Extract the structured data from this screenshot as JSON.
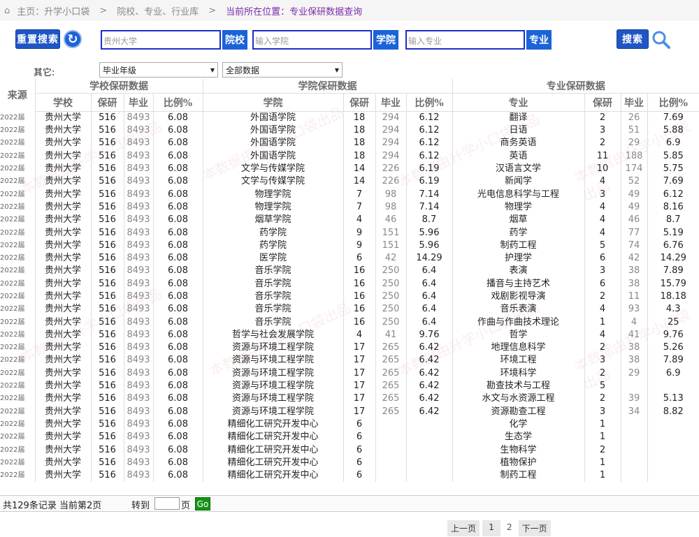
{
  "breadcrumb": {
    "home": "主页：升学小口袋",
    "level2": "院校、专业、行业库",
    "current": "当前所在位置：专业保研数据查询"
  },
  "toolbar": {
    "reset_label": "重置搜索",
    "school_input_value": "贵州大学",
    "school_btn": "院校",
    "college_placeholder": "输入学院",
    "college_btn": "学院",
    "major_placeholder": "输入专业",
    "major_btn": "专业",
    "search_label": "搜索"
  },
  "filters": {
    "label": "其它:",
    "grad_year": "毕业年级",
    "data_scope": "全部数据"
  },
  "table": {
    "col_source": "来源",
    "group_school": "学校保研数据",
    "group_college": "学院保研数据",
    "group_major": "专业保研数据",
    "h_school": "学校",
    "h_baoyan": "保研",
    "h_grad": "毕业",
    "h_ratio": "比例%",
    "h_college": "学院",
    "h_major": "专业",
    "rows": [
      {
        "src": "2022届",
        "school": "贵州大学",
        "sb": "516",
        "sg": "8493",
        "sr": "6.08",
        "college": "外国语学院",
        "cb": "18",
        "cg": "294",
        "cr": "6.12",
        "major": "翻译",
        "mb": "2",
        "mg": "26",
        "mr": "7.69"
      },
      {
        "src": "2022届",
        "school": "贵州大学",
        "sb": "516",
        "sg": "8493",
        "sr": "6.08",
        "college": "外国语学院",
        "cb": "18",
        "cg": "294",
        "cr": "6.12",
        "major": "日语",
        "mb": "3",
        "mg": "51",
        "mr": "5.88"
      },
      {
        "src": "2022届",
        "school": "贵州大学",
        "sb": "516",
        "sg": "8493",
        "sr": "6.08",
        "college": "外国语学院",
        "cb": "18",
        "cg": "294",
        "cr": "6.12",
        "major": "商务英语",
        "mb": "2",
        "mg": "29",
        "mr": "6.9"
      },
      {
        "src": "2022届",
        "school": "贵州大学",
        "sb": "516",
        "sg": "8493",
        "sr": "6.08",
        "college": "外国语学院",
        "cb": "18",
        "cg": "294",
        "cr": "6.12",
        "major": "英语",
        "mb": "11",
        "mg": "188",
        "mr": "5.85"
      },
      {
        "src": "2022届",
        "school": "贵州大学",
        "sb": "516",
        "sg": "8493",
        "sr": "6.08",
        "college": "文学与传媒学院",
        "cb": "14",
        "cg": "226",
        "cr": "6.19",
        "major": "汉语言文学",
        "mb": "10",
        "mg": "174",
        "mr": "5.75"
      },
      {
        "src": "2022届",
        "school": "贵州大学",
        "sb": "516",
        "sg": "8493",
        "sr": "6.08",
        "college": "文学与传媒学院",
        "cb": "14",
        "cg": "226",
        "cr": "6.19",
        "major": "新闻学",
        "mb": "4",
        "mg": "52",
        "mr": "7.69"
      },
      {
        "src": "2022届",
        "school": "贵州大学",
        "sb": "516",
        "sg": "8493",
        "sr": "6.08",
        "college": "物理学院",
        "cb": "7",
        "cg": "98",
        "cr": "7.14",
        "major": "光电信息科学与工程",
        "mb": "3",
        "mg": "49",
        "mr": "6.12"
      },
      {
        "src": "2022届",
        "school": "贵州大学",
        "sb": "516",
        "sg": "8493",
        "sr": "6.08",
        "college": "物理学院",
        "cb": "7",
        "cg": "98",
        "cr": "7.14",
        "major": "物理学",
        "mb": "4",
        "mg": "49",
        "mr": "8.16"
      },
      {
        "src": "2022届",
        "school": "贵州大学",
        "sb": "516",
        "sg": "8493",
        "sr": "6.08",
        "college": "烟草学院",
        "cb": "4",
        "cg": "46",
        "cr": "8.7",
        "major": "烟草",
        "mb": "4",
        "mg": "46",
        "mr": "8.7"
      },
      {
        "src": "2022届",
        "school": "贵州大学",
        "sb": "516",
        "sg": "8493",
        "sr": "6.08",
        "college": "药学院",
        "cb": "9",
        "cg": "151",
        "cr": "5.96",
        "major": "药学",
        "mb": "4",
        "mg": "77",
        "mr": "5.19"
      },
      {
        "src": "2022届",
        "school": "贵州大学",
        "sb": "516",
        "sg": "8493",
        "sr": "6.08",
        "college": "药学院",
        "cb": "9",
        "cg": "151",
        "cr": "5.96",
        "major": "制药工程",
        "mb": "5",
        "mg": "74",
        "mr": "6.76"
      },
      {
        "src": "2022届",
        "school": "贵州大学",
        "sb": "516",
        "sg": "8493",
        "sr": "6.08",
        "college": "医学院",
        "cb": "6",
        "cg": "42",
        "cr": "14.29",
        "major": "护理学",
        "mb": "6",
        "mg": "42",
        "mr": "14.29"
      },
      {
        "src": "2022届",
        "school": "贵州大学",
        "sb": "516",
        "sg": "8493",
        "sr": "6.08",
        "college": "音乐学院",
        "cb": "16",
        "cg": "250",
        "cr": "6.4",
        "major": "表演",
        "mb": "3",
        "mg": "38",
        "mr": "7.89"
      },
      {
        "src": "2022届",
        "school": "贵州大学",
        "sb": "516",
        "sg": "8493",
        "sr": "6.08",
        "college": "音乐学院",
        "cb": "16",
        "cg": "250",
        "cr": "6.4",
        "major": "播音与主持艺术",
        "mb": "6",
        "mg": "38",
        "mr": "15.79"
      },
      {
        "src": "2022届",
        "school": "贵州大学",
        "sb": "516",
        "sg": "8493",
        "sr": "6.08",
        "college": "音乐学院",
        "cb": "16",
        "cg": "250",
        "cr": "6.4",
        "major": "戏剧影视导演",
        "mb": "2",
        "mg": "11",
        "mr": "18.18"
      },
      {
        "src": "2022届",
        "school": "贵州大学",
        "sb": "516",
        "sg": "8493",
        "sr": "6.08",
        "college": "音乐学院",
        "cb": "16",
        "cg": "250",
        "cr": "6.4",
        "major": "音乐表演",
        "mb": "4",
        "mg": "93",
        "mr": "4.3"
      },
      {
        "src": "2022届",
        "school": "贵州大学",
        "sb": "516",
        "sg": "8493",
        "sr": "6.08",
        "college": "音乐学院",
        "cb": "16",
        "cg": "250",
        "cr": "6.4",
        "major": "作曲与作曲技术理论",
        "mb": "1",
        "mg": "4",
        "mr": "25"
      },
      {
        "src": "2022届",
        "school": "贵州大学",
        "sb": "516",
        "sg": "8493",
        "sr": "6.08",
        "college": "哲学与社会发展学院",
        "cb": "4",
        "cg": "41",
        "cr": "9.76",
        "major": "哲学",
        "mb": "4",
        "mg": "41",
        "mr": "9.76"
      },
      {
        "src": "2022届",
        "school": "贵州大学",
        "sb": "516",
        "sg": "8493",
        "sr": "6.08",
        "college": "资源与环境工程学院",
        "cb": "17",
        "cg": "265",
        "cr": "6.42",
        "major": "地理信息科学",
        "mb": "2",
        "mg": "38",
        "mr": "5.26"
      },
      {
        "src": "2022届",
        "school": "贵州大学",
        "sb": "516",
        "sg": "8493",
        "sr": "6.08",
        "college": "资源与环境工程学院",
        "cb": "17",
        "cg": "265",
        "cr": "6.42",
        "major": "环境工程",
        "mb": "3",
        "mg": "38",
        "mr": "7.89"
      },
      {
        "src": "2022届",
        "school": "贵州大学",
        "sb": "516",
        "sg": "8493",
        "sr": "6.08",
        "college": "资源与环境工程学院",
        "cb": "17",
        "cg": "265",
        "cr": "6.42",
        "major": "环境科学",
        "mb": "2",
        "mg": "29",
        "mr": "6.9"
      },
      {
        "src": "2022届",
        "school": "贵州大学",
        "sb": "516",
        "sg": "8493",
        "sr": "6.08",
        "college": "资源与环境工程学院",
        "cb": "17",
        "cg": "265",
        "cr": "6.42",
        "major": "勘查技术与工程",
        "mb": "5",
        "mg": "",
        "mr": ""
      },
      {
        "src": "2022届",
        "school": "贵州大学",
        "sb": "516",
        "sg": "8493",
        "sr": "6.08",
        "college": "资源与环境工程学院",
        "cb": "17",
        "cg": "265",
        "cr": "6.42",
        "major": "水文与水资源工程",
        "mb": "2",
        "mg": "39",
        "mr": "5.13"
      },
      {
        "src": "2022届",
        "school": "贵州大学",
        "sb": "516",
        "sg": "8493",
        "sr": "6.08",
        "college": "资源与环境工程学院",
        "cb": "17",
        "cg": "265",
        "cr": "6.42",
        "major": "资源勘查工程",
        "mb": "3",
        "mg": "34",
        "mr": "8.82"
      },
      {
        "src": "2022届",
        "school": "贵州大学",
        "sb": "516",
        "sg": "8493",
        "sr": "6.08",
        "college": "精细化工研究开发中心",
        "cb": "6",
        "cg": "",
        "cr": "",
        "major": "化学",
        "mb": "1",
        "mg": "",
        "mr": ""
      },
      {
        "src": "2022届",
        "school": "贵州大学",
        "sb": "516",
        "sg": "8493",
        "sr": "6.08",
        "college": "精细化工研究开发中心",
        "cb": "6",
        "cg": "",
        "cr": "",
        "major": "生态学",
        "mb": "1",
        "mg": "",
        "mr": ""
      },
      {
        "src": "2022届",
        "school": "贵州大学",
        "sb": "516",
        "sg": "8493",
        "sr": "6.08",
        "college": "精细化工研究开发中心",
        "cb": "6",
        "cg": "",
        "cr": "",
        "major": "生物科学",
        "mb": "2",
        "mg": "",
        "mr": ""
      },
      {
        "src": "2022届",
        "school": "贵州大学",
        "sb": "516",
        "sg": "8493",
        "sr": "6.08",
        "college": "精细化工研究开发中心",
        "cb": "6",
        "cg": "",
        "cr": "",
        "major": "植物保护",
        "mb": "1",
        "mg": "",
        "mr": ""
      },
      {
        "src": "2022届",
        "school": "贵州大学",
        "sb": "516",
        "sg": "8493",
        "sr": "6.08",
        "college": "精细化工研究开发中心",
        "cb": "6",
        "cg": "",
        "cr": "",
        "major": "制药工程",
        "mb": "1",
        "mg": "",
        "mr": ""
      }
    ]
  },
  "footer": {
    "records": "共129条记录 当前第2页",
    "goto": "转到",
    "page_unit": "页",
    "go": "Go"
  },
  "pager": {
    "prev": "上一页",
    "p1": "1",
    "p2": "2",
    "next": "下一页"
  },
  "watermark": "本数据由升学小口袋出品"
}
